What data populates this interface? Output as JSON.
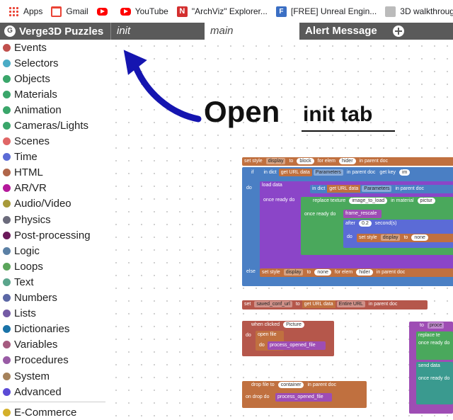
{
  "bookmarks": [
    {
      "label": "Apps",
      "icon": "apps-grid-icon"
    },
    {
      "label": "Gmail",
      "icon": "gmail-icon"
    },
    {
      "label": "",
      "icon": "youtube-icon"
    },
    {
      "label": "YouTube",
      "icon": "youtube-icon"
    },
    {
      "label": "\"ArchViz\" Explorer...",
      "icon": "n-logo-icon"
    },
    {
      "label": "[FREE] Unreal Engin...",
      "icon": "unreal-icon"
    },
    {
      "label": "3D walkthrough de...",
      "icon": "thumbnail-icon"
    }
  ],
  "app": {
    "title": "Verge3D Puzzles",
    "logo_letter": "G"
  },
  "tabs": [
    {
      "label": "init"
    },
    {
      "label": "main"
    },
    {
      "label": "Alert Message"
    }
  ],
  "toolbox": {
    "categories": [
      {
        "label": "Events",
        "color": "#c0504d"
      },
      {
        "label": "Selectors",
        "color": "#4bacc6"
      },
      {
        "label": "Objects",
        "color": "#3aa66a"
      },
      {
        "label": "Materials",
        "color": "#3aa66a"
      },
      {
        "label": "Animation",
        "color": "#3aa66a"
      },
      {
        "label": "Cameras/Lights",
        "color": "#3aa66a"
      },
      {
        "label": "Scenes",
        "color": "#e06666"
      },
      {
        "label": "Time",
        "color": "#5b6bd6"
      },
      {
        "label": "HTML",
        "color": "#b0664a"
      },
      {
        "label": "AR/VR",
        "color": "#b5199b"
      },
      {
        "label": "Audio/Video",
        "color": "#a89a3a"
      },
      {
        "label": "Physics",
        "color": "#6b6b7b"
      },
      {
        "label": "Post-processing",
        "color": "#6a1a5a"
      },
      {
        "label": "Logic",
        "color": "#5b80a5"
      },
      {
        "label": "Loops",
        "color": "#5ba55b"
      },
      {
        "label": "Text",
        "color": "#5ba58c"
      },
      {
        "label": "Numbers",
        "color": "#5b67a5"
      },
      {
        "label": "Lists",
        "color": "#745ba5"
      },
      {
        "label": "Dictionaries",
        "color": "#1a73a8"
      },
      {
        "label": "Variables",
        "color": "#a55b80"
      },
      {
        "label": "Procedures",
        "color": "#995ba5"
      },
      {
        "label": "System",
        "color": "#a5825b"
      },
      {
        "label": "Advanced",
        "color": "#5b4bd6"
      }
    ],
    "extra": [
      {
        "label": "E-Commerce",
        "color": "#d4b02a"
      }
    ]
  },
  "annotation": {
    "open": "Open",
    "tab_name": "init tab"
  },
  "blocks": {
    "set_style_1": {
      "set": "set style",
      "prop": "display",
      "to": "to",
      "val": "block",
      "for": "for elem",
      "elem": "hider",
      "in": "in parent doc"
    },
    "if": {
      "if": "if",
      "in_dict": "in dict",
      "get_url": "get URL data",
      "params": "Parameters",
      "in_parent": "in parent doc",
      "get_key": "get key",
      "key_val": "im"
    },
    "do": "do",
    "load_data": "load data",
    "once_ready": "once ready do",
    "inner_dict": {
      "in_dict": "in dict",
      "get_url": "get URL data",
      "params": "Parameters",
      "in_parent": "in parent doc"
    },
    "replace_texture": {
      "label": "replace texture",
      "img": "image_to_load",
      "in_mat": "in material",
      "mat": "pictur"
    },
    "once_ready_2": "once ready do",
    "frame_rescale": "frame_rescale",
    "after": {
      "label": "after",
      "num": "0.2",
      "unit": "second(s)"
    },
    "do2": "do",
    "set_style_2": {
      "set": "set style",
      "prop": "display",
      "to": "to",
      "val": "none"
    },
    "else": "else",
    "set_style_3": {
      "set": "set style",
      "prop": "display",
      "to": "to",
      "val": "none",
      "for": "for elem",
      "elem": "hider",
      "in": "in parent doc"
    },
    "set_var": {
      "set": "set",
      "var": "saved_conf_url",
      "to": "to",
      "get_url": "get URL data",
      "entire": "Entire URL",
      "in": "in parent doc"
    },
    "when_clicked": {
      "label": "when clicked",
      "obj": "Picture",
      "do": "do",
      "open_file": "open file",
      "do2": "do",
      "proc": "process_opened_file"
    },
    "drop_file": {
      "label": "drop file to",
      "elem": "container",
      "in": "in parent doc",
      "on_drop": "on drop do",
      "proc": "process_opened_file"
    },
    "right_proc": {
      "to": "to",
      "name": "proce",
      "replace": "replace te",
      "once": "once ready do",
      "send": "send data",
      "once2": "once ready do"
    }
  }
}
